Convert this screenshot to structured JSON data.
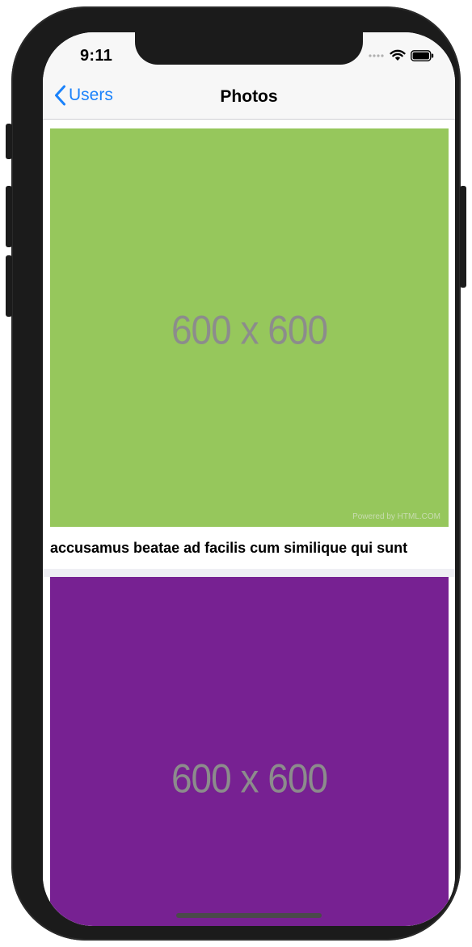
{
  "status_bar": {
    "time": "9:11",
    "icons": [
      "signal-dots-icon",
      "wifi-icon",
      "battery-icon"
    ]
  },
  "nav": {
    "back_label": "Users",
    "title": "Photos",
    "accent_color": "#1a82fb"
  },
  "photos": [
    {
      "placeholder_text": "600 x 600",
      "watermark": "Powered by HTML.COM",
      "color": "#96c75c",
      "caption": "accusamus beatae ad facilis cum similique qui sunt"
    },
    {
      "placeholder_text": "600 x 600",
      "color": "#772192"
    }
  ]
}
